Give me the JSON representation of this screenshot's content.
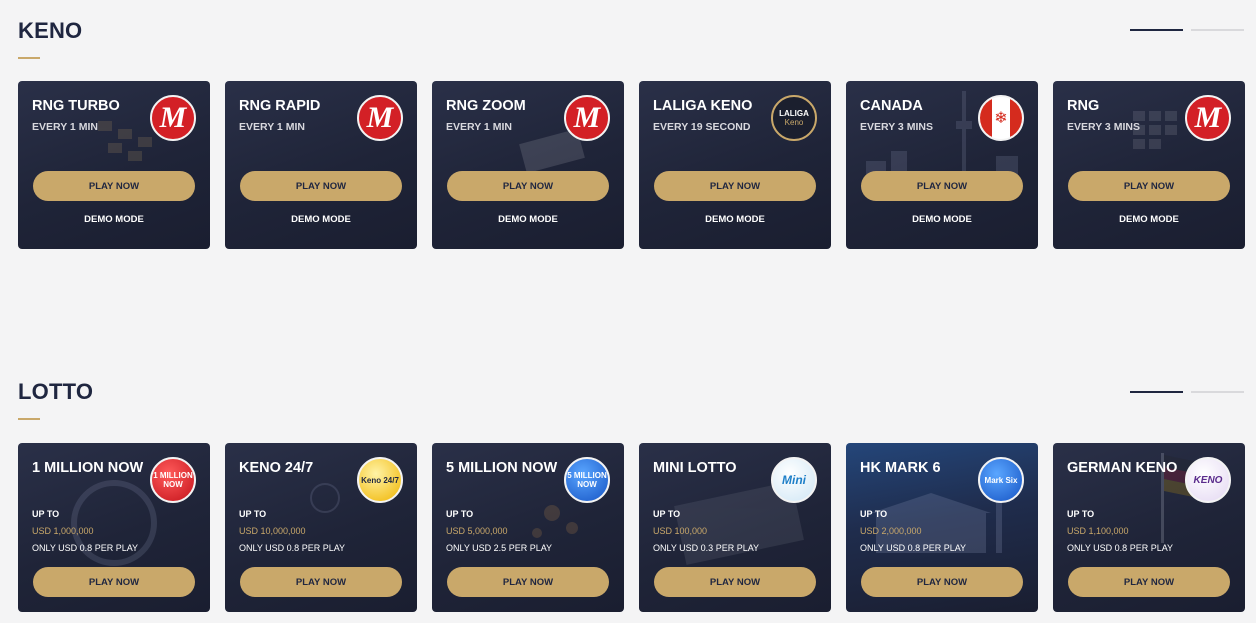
{
  "keno": {
    "title": "KENO",
    "cards": [
      {
        "name": "RNG TURBO",
        "sub": "EVERY 1 MIN",
        "logo": "m-logo-icon",
        "play": "PLAY NOW",
        "demo": "DEMO MODE"
      },
      {
        "name": "RNG RAPID",
        "sub": "EVERY 1 MIN",
        "logo": "m-logo-icon",
        "play": "PLAY NOW",
        "demo": "DEMO MODE"
      },
      {
        "name": "RNG ZOOM",
        "sub": "EVERY 1 MIN",
        "logo": "m-logo-icon",
        "play": "PLAY NOW",
        "demo": "DEMO MODE"
      },
      {
        "name": "LALIGA KENO",
        "sub": "EVERY 19 SECOND",
        "logo": "laliga-keno-icon",
        "logo_text_1": "LALIGA",
        "logo_text_2": "Keno",
        "play": "PLAY NOW",
        "demo": "DEMO MODE"
      },
      {
        "name": "CANADA",
        "sub": "EVERY 3 MINS",
        "logo": "canada-flag-icon",
        "play": "PLAY NOW",
        "demo": "DEMO MODE"
      },
      {
        "name": "RNG",
        "sub": "EVERY 3 MINS",
        "logo": "m-logo-icon",
        "play": "PLAY NOW",
        "demo": "DEMO MODE"
      }
    ]
  },
  "lotto": {
    "title": "LOTTO",
    "cards": [
      {
        "name": "1 MILLION NOW",
        "upto": "UP TO",
        "prize": "USD 1,000,000",
        "per_play": "ONLY USD 0.8 PER PLAY",
        "logo_text": "1 MILLION NOW",
        "play": "PLAY NOW"
      },
      {
        "name": "KENO 24/7",
        "upto": "UP TO",
        "prize": "USD 10,000,000",
        "per_play": "ONLY USD 0.8 PER PLAY",
        "logo_text": "Keno 24/7",
        "play": "PLAY NOW"
      },
      {
        "name": "5 MILLION NOW",
        "upto": "UP TO",
        "prize": "USD 5,000,000",
        "per_play": "ONLY USD 2.5 PER PLAY",
        "logo_text": "5 MILLION NOW",
        "play": "PLAY NOW"
      },
      {
        "name": "MINI LOTTO",
        "upto": "UP TO",
        "prize": "USD 100,000",
        "per_play": "ONLY USD 0.3 PER PLAY",
        "logo_text": "Mini",
        "play": "PLAY NOW"
      },
      {
        "name": "HK MARK 6",
        "upto": "UP TO",
        "prize": "USD 2,000,000",
        "per_play": "ONLY USD 0.8 PER PLAY",
        "logo_text": "Mark Six",
        "play": "PLAY NOW"
      },
      {
        "name": "GERMAN KENO",
        "upto": "UP TO",
        "prize": "USD 1,100,000",
        "per_play": "ONLY USD 0.8 PER PLAY",
        "logo_text": "KENO",
        "play": "PLAY NOW"
      }
    ]
  },
  "colors": {
    "accent": "#c9a86a",
    "card_bg": "#1f2438",
    "page_bg": "#f4f4f5",
    "title": "#1f2640"
  }
}
